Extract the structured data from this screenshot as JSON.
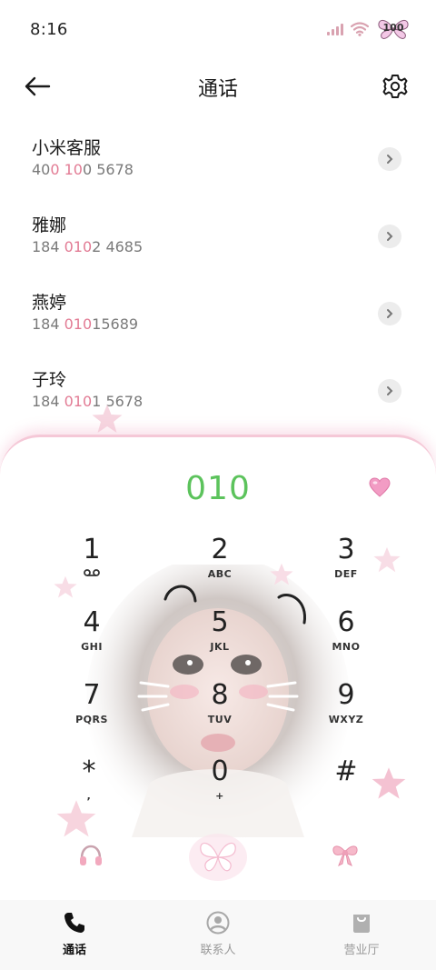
{
  "status_bar": {
    "time": "8:16",
    "battery": "100"
  },
  "header": {
    "title": "通话"
  },
  "contacts": [
    {
      "name": "小米客服",
      "number_parts": [
        "40",
        "0 10",
        "0 5678"
      ]
    },
    {
      "name": "雅娜",
      "number_parts": [
        "184 ",
        "010",
        "2 4685"
      ]
    },
    {
      "name": "燕婷",
      "number_parts": [
        "184 ",
        "010",
        "15689"
      ]
    },
    {
      "name": "子玲",
      "number_parts": [
        "184 ",
        "010",
        "1 5678"
      ]
    }
  ],
  "dialer": {
    "display": "010",
    "keys": [
      {
        "digit": "1",
        "letters": ""
      },
      {
        "digit": "2",
        "letters": "ABC"
      },
      {
        "digit": "3",
        "letters": "DEF"
      },
      {
        "digit": "4",
        "letters": "GHI"
      },
      {
        "digit": "5",
        "letters": "JKL"
      },
      {
        "digit": "6",
        "letters": "MNO"
      },
      {
        "digit": "7",
        "letters": "PQRS"
      },
      {
        "digit": "8",
        "letters": "TUV"
      },
      {
        "digit": "9",
        "letters": "WXYZ"
      },
      {
        "digit": "*",
        "letters": ","
      },
      {
        "digit": "0",
        "letters": "+"
      },
      {
        "digit": "#",
        "letters": ""
      }
    ]
  },
  "bottom_nav": [
    {
      "label": "通话",
      "icon": "phone-icon",
      "active": true
    },
    {
      "label": "联系人",
      "icon": "contacts-icon",
      "active": false
    },
    {
      "label": "营业厅",
      "icon": "shop-bag-icon",
      "active": false
    }
  ],
  "colors": {
    "accent_green": "#5cc35c",
    "highlight_pink": "#e27b94",
    "panel_border": "#f5c8d7"
  }
}
